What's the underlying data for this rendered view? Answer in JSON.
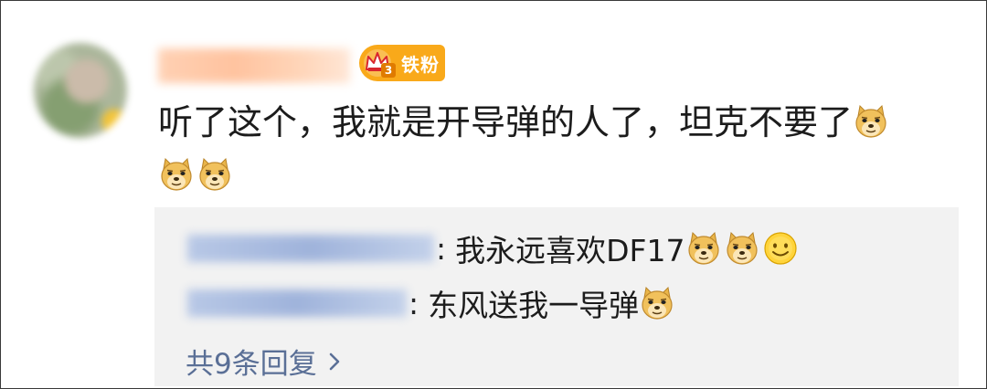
{
  "comment": {
    "username": "",
    "fan_badge": {
      "level": "3",
      "label": "铁粉"
    },
    "text": "听了这个，我就是开导弹的人了，坦克不要了",
    "emojis": [
      "doge-emoji",
      "doge-emoji",
      "doge-emoji"
    ]
  },
  "replies": [
    {
      "name": "",
      "separator": ":",
      "text": "我永远喜欢DF17",
      "emojis": [
        "doge-emoji",
        "doge-emoji",
        "smile-emoji"
      ]
    },
    {
      "name": "",
      "separator": ":",
      "text": "东风送我一导弹",
      "emojis": [
        "doge-emoji"
      ]
    }
  ],
  "more_replies": {
    "label": "共9条回复",
    "icon": "chevron-right-icon"
  },
  "colors": {
    "badge": "#f9a91a",
    "link": "#5a6f96",
    "reply_bg": "#f2f2f2",
    "text": "#1c1c1c"
  }
}
